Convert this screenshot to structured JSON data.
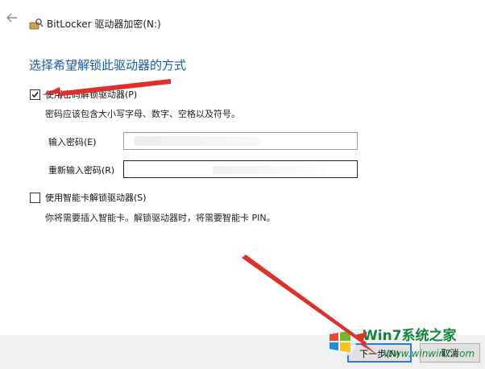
{
  "window": {
    "title": "BitLocker 驱动器加密(N:)",
    "back_icon": "arrow-left-icon",
    "app_icon": "bitlocker-key-icon"
  },
  "page": {
    "heading": "选择希望解锁此驱动器的方式"
  },
  "password_option": {
    "label": "使用密码解锁驱动器(P)",
    "checked": true,
    "hint": "密码应该包含大小写字母、数字、空格以及符号。",
    "enter_label": "输入密码(E)",
    "reenter_label": "重新输入密码(R)"
  },
  "smartcard_option": {
    "label": "使用智能卡解锁驱动器(S)",
    "checked": false,
    "hint": "你将需要插入智能卡。解锁驱动器时，将需要智能卡 PIN。"
  },
  "footer": {
    "next_label": "下一步(N)",
    "cancel_label": "取消"
  },
  "watermark": {
    "site": "Win7系统之家",
    "url": "Www.winwin7.com"
  },
  "colors": {
    "heading": "#1a5aa8",
    "annotation_arrow": "#e0302a",
    "focus_border": "#2a7be0",
    "watermark": "#13853a"
  }
}
